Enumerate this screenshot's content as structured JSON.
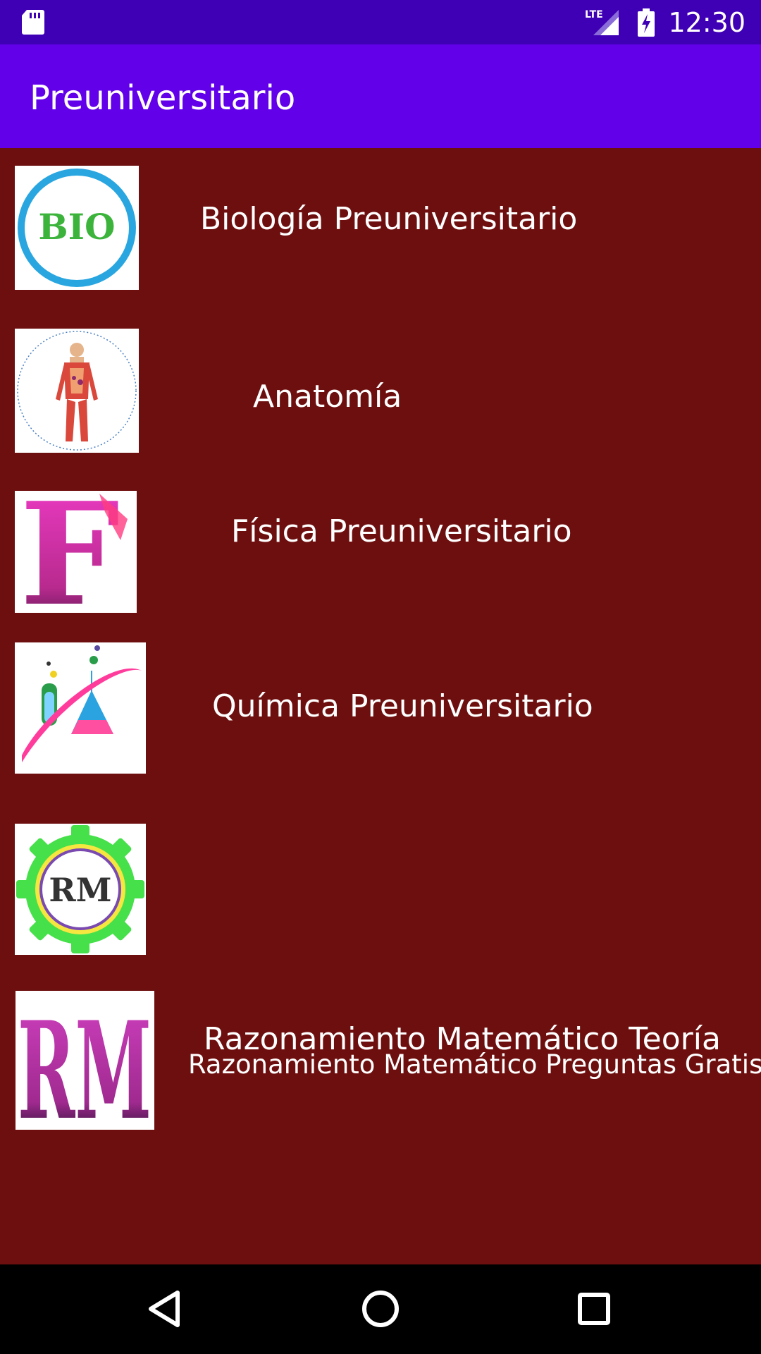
{
  "status_bar": {
    "network": "LTE",
    "time": "12:30"
  },
  "app_bar": {
    "title": "Preuniversitario"
  },
  "items": [
    {
      "label": "Biología Preuniversitario",
      "thumb_text": "BIO"
    },
    {
      "label": "Anatomía"
    },
    {
      "label": "Física Preuniversitario",
      "thumb_text": "F"
    },
    {
      "label": "Química Preuniversitario"
    },
    {
      "label": "Razonamiento Matemático Teoría",
      "thumb_text": "RM"
    },
    {
      "label": "Razonamiento Matemático Preguntas Gratis",
      "thumb_text": "RM"
    }
  ],
  "nav": {
    "back_icon": "back-triangle-icon",
    "home_icon": "home-circle-icon",
    "recents_icon": "recents-square-icon"
  },
  "colors": {
    "status_bar": "#3f00b5",
    "app_bar": "#6200ea",
    "list_background": "#6e0f0f",
    "nav_bar": "#000000"
  }
}
